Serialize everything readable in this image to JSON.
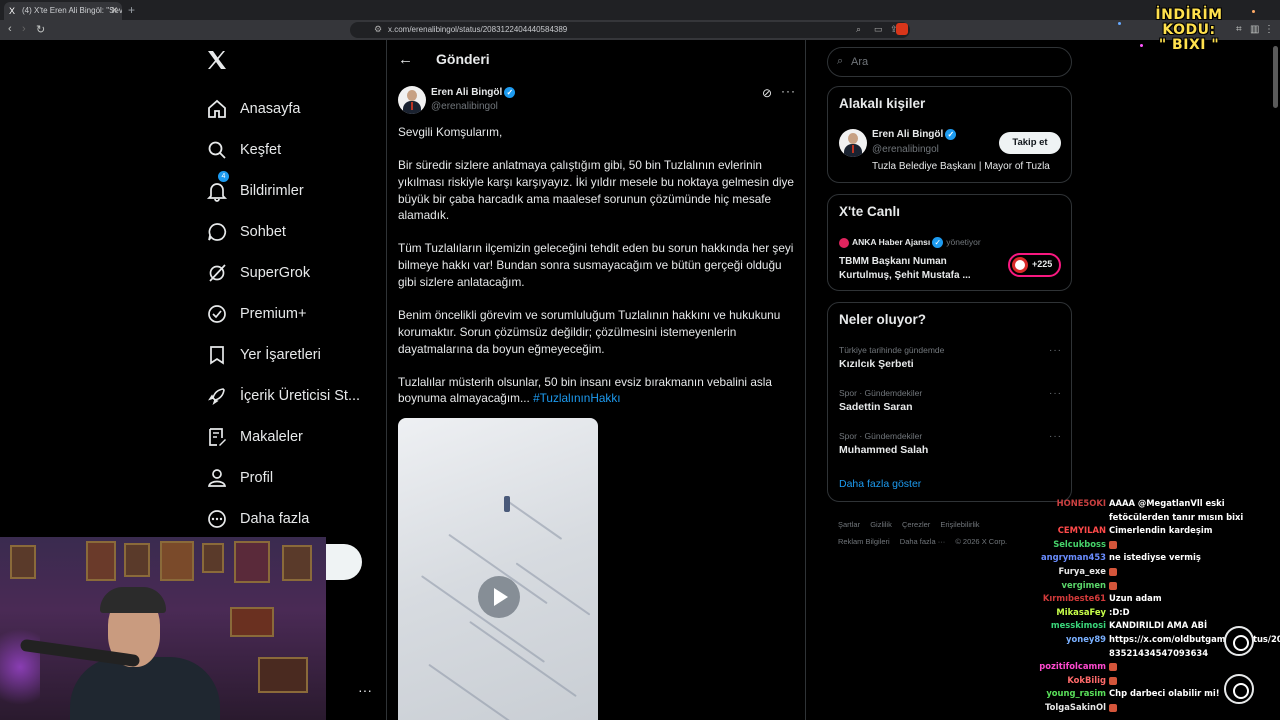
{
  "browser": {
    "tab_title": "(4) X'te Eren Ali Bingöl: \"Sevgili K",
    "url": "x.com/erenalibingol/status/2083122404440584389"
  },
  "overlay": {
    "promo_line1": "İNDİRİM KODU:",
    "promo_line2": "\" BIXI \""
  },
  "nav": {
    "items": [
      {
        "label": "Anasayfa",
        "icon": "home-icon"
      },
      {
        "label": "Keşfet",
        "icon": "search-icon"
      },
      {
        "label": "Bildirimler",
        "icon": "bell-icon",
        "badge": "4"
      },
      {
        "label": "Sohbet",
        "icon": "chat-icon"
      },
      {
        "label": "SuperGrok",
        "icon": "grok-icon"
      },
      {
        "label": "Premium+",
        "icon": "verified-icon"
      },
      {
        "label": "Yer İşaretleri",
        "icon": "bookmark-icon"
      },
      {
        "label": "İçerik Üreticisi St...",
        "icon": "rocket-icon"
      },
      {
        "label": "Makaleler",
        "icon": "article-icon"
      },
      {
        "label": "Profil",
        "icon": "person-icon"
      },
      {
        "label": "Daha fazla",
        "icon": "more-circle-icon"
      }
    ]
  },
  "main": {
    "header_title": "Gönderi",
    "author_name": "Eren Ali Bingöl",
    "author_handle": "@erenalibingol",
    "tweet": {
      "p1": "Sevgili Komşularım,",
      "p2": "Bir süredir sizlere anlatmaya çalıştığım gibi, 50 bin Tuzlalının evlerinin yıkılması riskiyle karşı karşıyayız. İki yıldır mesele bu noktaya gelmesin diye büyük bir çaba harcadık ama maalesef sorunun çözümünde hiç mesafe alamadık.",
      "p3": "Tüm Tuzlalıların ilçemizin geleceğini tehdit eden bu sorun hakkında her şeyi bilmeye hakkı var! Bundan sonra susmayacağım ve bütün gerçeği olduğu gibi sizlere anlatacağım.",
      "p4": "Benim öncelikli görevim ve sorumluluğum Tuzlalının hakkını ve hukukunu korumaktır. Sorun çözümsüz değildir; çözülmesini istemeyenlerin dayatmalarına da boyun eğmeyeceğim.",
      "p5": "Tuzlalılar müsterih olsunlar, 50 bin insanı evsiz bırakmanın vebalini asla boynuma almayacağım...",
      "hashtag": "#TuzlalınınHakkı"
    }
  },
  "sidebar": {
    "search_placeholder": "Ara",
    "related": {
      "title": "Alakalı kişiler",
      "name": "Eren Ali Bingöl",
      "handle": "@erenalibingol",
      "bio": "Tuzla Belediye Başkanı | Mayor of Tuzla",
      "follow_label": "Takip et"
    },
    "live": {
      "title": "X'te Canlı",
      "source": "ANKA Haber Ajansı",
      "role": "yönetiyor",
      "headline": "TBMM Başkanı Numan Kurtulmuş, Şehit Mustafa ...",
      "count": "+225"
    },
    "trends": {
      "title": "Neler oluyor?",
      "items": [
        {
          "category": "Türkiye tarihinde gündemde",
          "name": "Kızılcık Şerbeti"
        },
        {
          "category": "Spor · Gündemdekiler",
          "name": "Sadettin Saran"
        },
        {
          "category": "Spor · Gündemdekiler",
          "name": "Muhammed Salah"
        }
      ],
      "show_more": "Daha fazla göster"
    },
    "footer": {
      "links": [
        "Şartlar",
        "Gizlilik",
        "Çerezler",
        "Erişilebilirlik",
        "Reklam Bilgileri",
        "Daha fazla ···",
        "© 2026 X Corp."
      ]
    }
  },
  "chat": {
    "messages": [
      {
        "user": "HONE5OKI",
        "color": "#c94040",
        "text": "AAAA @MegatlanVll eski"
      },
      {
        "user": "",
        "color": "#ffffff",
        "text": "fetöcülerden tanır mısın bixi"
      },
      {
        "user": "CEMYILAN",
        "color": "#ff4a4a",
        "text": "Cimerlendin kardeşim"
      },
      {
        "user": "Selcukboss",
        "color": "#46d36a",
        "text": ""
      },
      {
        "user": "angryman453",
        "color": "#6a8dff",
        "text": "ne istediyse vermiş"
      },
      {
        "user": "Furya_exe",
        "color": "#e8e8e8",
        "text": ""
      },
      {
        "user": "vergimen",
        "color": "#5ad66a",
        "text": ""
      },
      {
        "user": "Kırmıbeste61",
        "color": "#d23a3a",
        "text": "Uzun adam"
      },
      {
        "user": "MikasaFey",
        "color": "#c8ff4a",
        "text": ":D:D"
      },
      {
        "user": "messkimosi",
        "color": "#3ad67a",
        "text": "KANDIRILDI AMA ABİ"
      },
      {
        "user": "yoney89",
        "color": "#7ab0ff",
        "text": "https://x.com/oldbutgamer/status/20"
      },
      {
        "user": "",
        "color": "#ffffff",
        "text": "83521434547093634"
      },
      {
        "user": "pozitifolcamm",
        "color": "#ff4ad0",
        "text": ""
      },
      {
        "user": "KokBilig",
        "color": "#ff6a6a",
        "text": ""
      },
      {
        "user": "young_rasim",
        "color": "#5ae05a",
        "text": "Chp darbeci olabilir mi!"
      },
      {
        "user": "TolgaSakinOl",
        "color": "#e8e8e8",
        "text": ""
      }
    ]
  }
}
